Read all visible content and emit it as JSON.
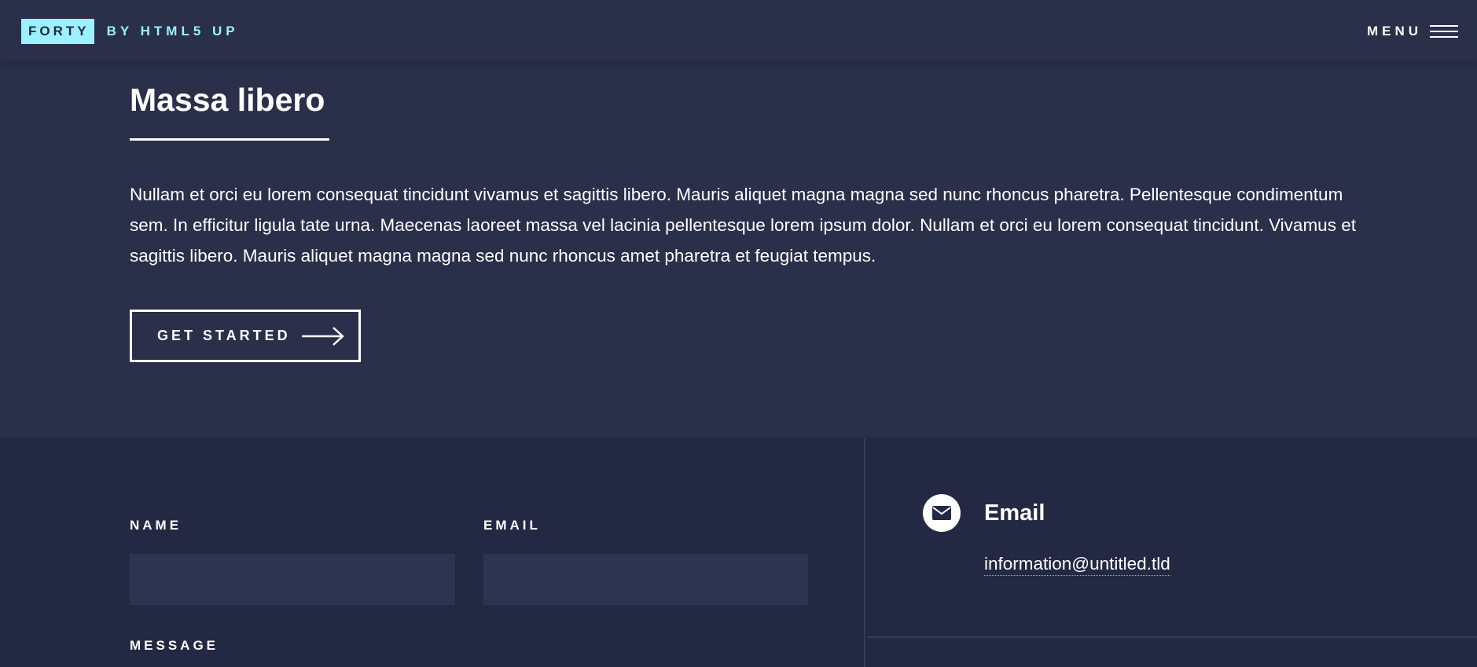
{
  "header": {
    "logo_box": "FORTY",
    "logo_by": "BY HTML5 UP",
    "menu_label": "MENU"
  },
  "banner": {
    "title": "Massa libero",
    "lead": "Nullam et orci eu lorem consequat tincidunt vivamus et sagittis libero. Mauris aliquet magna magna sed nunc rhoncus pharetra. Pellentesque condimentum sem. In efficitur ligula tate urna. Maecenas laoreet massa vel lacinia pellentesque lorem ipsum dolor. Nullam et orci eu lorem consequat tincidunt. Vivamus et sagittis libero. Mauris aliquet magna magna sed nunc rhoncus amet pharetra et feugiat tempus.",
    "cta_label": "GET STARTED"
  },
  "form": {
    "name_label": "NAME",
    "name_value": "",
    "email_label": "EMAIL",
    "email_value": "",
    "message_label": "MESSAGE"
  },
  "contact_info": {
    "email_title": "Email",
    "email_address": "information@untitled.tld"
  },
  "icons": {
    "menu": "hamburger-icon",
    "cta": "arrow-right-icon",
    "email": "envelope-icon"
  },
  "colors": {
    "background": "#2a2f4a",
    "contact_background": "#242943",
    "accent": "#9bf1ff",
    "input_background": "#2e3450"
  }
}
